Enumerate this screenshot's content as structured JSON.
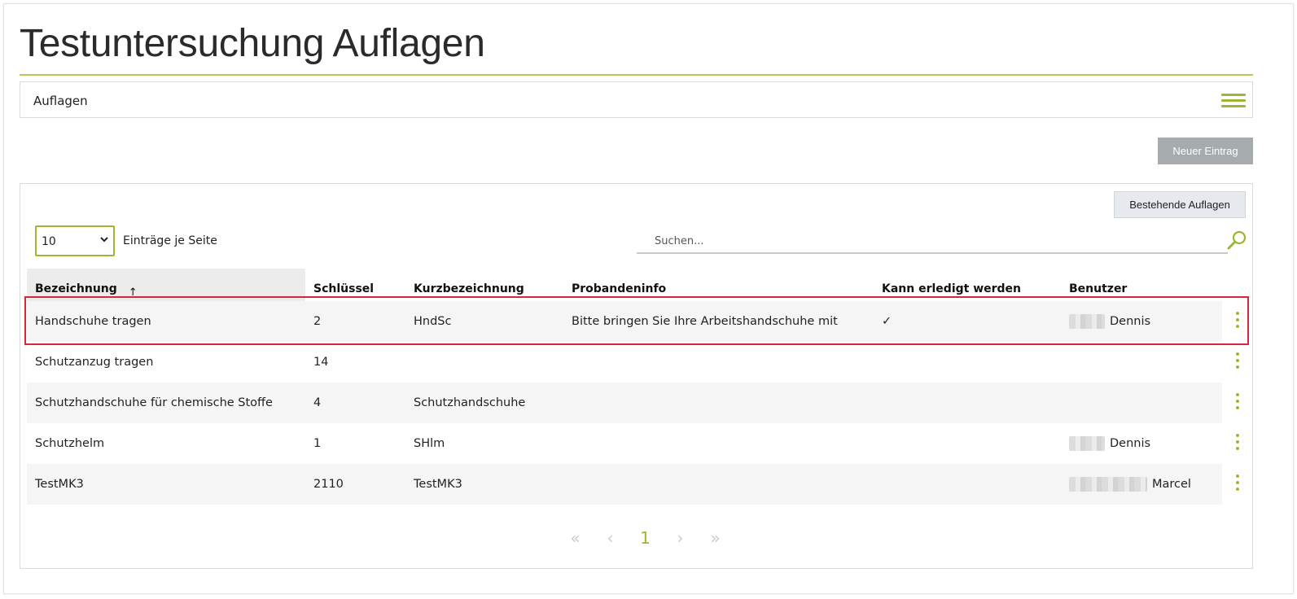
{
  "page": {
    "title": "Testuntersuchung Auflagen"
  },
  "section": {
    "label": "Auflagen",
    "menu_icon": "hamburger-icon"
  },
  "toolbar": {
    "new_entry_label": "Neuer Eintrag",
    "existing_label": "Bestehende Auflagen"
  },
  "table_controls": {
    "page_size_value": "10",
    "page_size_label": "Einträge je Seite",
    "search_placeholder": "Suchen..."
  },
  "table": {
    "columns": [
      "Bezeichnung",
      "Schlüssel",
      "Kurzbezeichnung",
      "Probandeninfo",
      "Kann erledigt werden",
      "Benutzer"
    ],
    "sort_indicator": "↑",
    "rows": [
      {
        "bezeichnung": "Handschuhe tragen",
        "schluessel": "2",
        "kurz": "HndSc",
        "info": "Bitte bringen Sie Ihre Arbeitshandschuhe mit",
        "erledigt": "✓",
        "benutzer": "Dennis"
      },
      {
        "bezeichnung": "Schutzanzug tragen",
        "schluessel": "14",
        "kurz": "",
        "info": "",
        "erledigt": "",
        "benutzer": ""
      },
      {
        "bezeichnung": "Schutzhandschuhe für chemische Stoffe",
        "schluessel": "4",
        "kurz": "Schutzhandschuhe",
        "info": "",
        "erledigt": "",
        "benutzer": ""
      },
      {
        "bezeichnung": "Schutzhelm",
        "schluessel": "1",
        "kurz": "SHlm",
        "info": "",
        "erledigt": "",
        "benutzer": "Dennis"
      },
      {
        "bezeichnung": "TestMK3",
        "schluessel": "2110",
        "kurz": "TestMK3",
        "info": "",
        "erledigt": "",
        "benutzer": "Marcel"
      }
    ]
  },
  "pagination": {
    "first": "«",
    "prev": "‹",
    "current": "1",
    "next": "›",
    "last": "»"
  },
  "colors": {
    "accent": "#9ab833",
    "highlight": "#d9263e",
    "button_gray": "#a6abad"
  }
}
